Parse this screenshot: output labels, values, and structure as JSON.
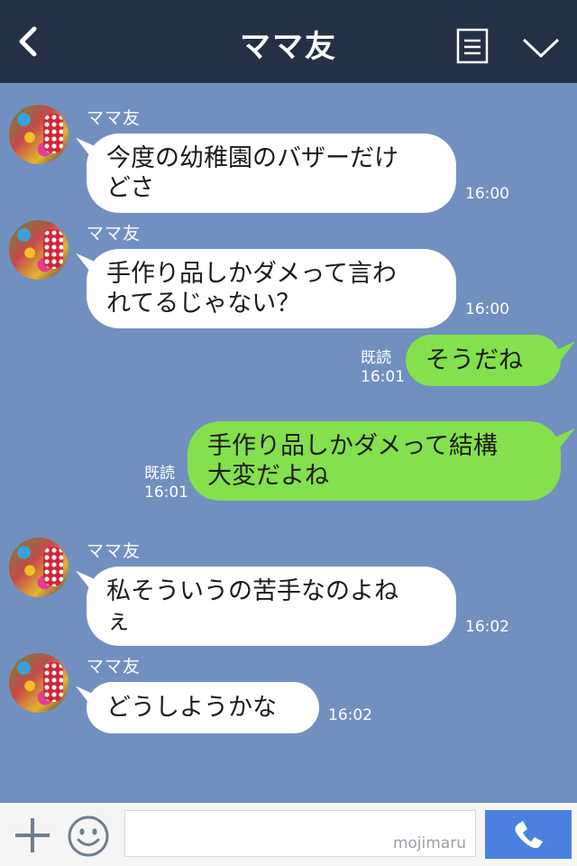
{
  "header": {
    "title": "ママ友",
    "back_icon": "chevron-left-icon",
    "menu_icon": "list-icon",
    "collapse_icon": "chevron-down-icon",
    "bg_color": "#233045"
  },
  "chat": {
    "bg_color": "#7190c0",
    "incoming_bubble_color": "#ffffff",
    "outgoing_bubble_color": "#84e04c",
    "messages": [
      {
        "direction": "in",
        "sender": "ママ友",
        "lines": [
          "今度の幼稚園のバザーだけ",
          "どさ"
        ],
        "time": "16:00"
      },
      {
        "direction": "in",
        "sender": "ママ友",
        "lines": [
          "手作り品しかダメって言わ",
          "れてるじゃない？"
        ],
        "time": "16:00"
      },
      {
        "direction": "out",
        "read": "既読",
        "lines": [
          "そうだね"
        ],
        "time": "16:01"
      },
      {
        "direction": "out",
        "read": "既読",
        "lines": [
          "手作り品しかダメって結構",
          "大変だよね"
        ],
        "time": "16:01"
      },
      {
        "direction": "in",
        "sender": "ママ友",
        "lines": [
          "私そういうの苦手なのよね",
          "ぇ"
        ],
        "time": "16:02"
      },
      {
        "direction": "in",
        "sender": "ママ友",
        "lines": [
          "どうしようかな"
        ],
        "time": "16:02"
      }
    ]
  },
  "footer": {
    "add_icon": "plus-icon",
    "sticker_icon": "smiley-icon",
    "input_value": "",
    "watermark": "mojimaru",
    "call_icon": "phone-icon",
    "call_button_color": "#4a80e0"
  }
}
